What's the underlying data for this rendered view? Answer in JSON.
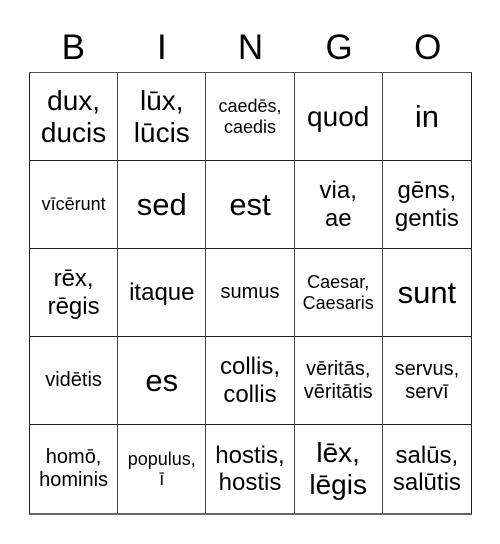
{
  "header": {
    "letters": [
      "B",
      "I",
      "N",
      "G",
      "O"
    ]
  },
  "board": {
    "cells": [
      {
        "text": "dux,\nducis",
        "size": "l"
      },
      {
        "text": "lūx,\nlūcis",
        "size": "l"
      },
      {
        "text": "caedēs,\ncaedis",
        "size": "xs"
      },
      {
        "text": "quod",
        "size": "l"
      },
      {
        "text": "in",
        "size": "xl"
      },
      {
        "text": "vīcērunt",
        "size": "xs"
      },
      {
        "text": "sed",
        "size": "xl"
      },
      {
        "text": "est",
        "size": "xl"
      },
      {
        "text": "via,\nae",
        "size": "m"
      },
      {
        "text": "gēns,\ngentis",
        "size": "m"
      },
      {
        "text": "rēx,\nrēgis",
        "size": "m"
      },
      {
        "text": "itaque",
        "size": "m"
      },
      {
        "text": "sumus",
        "size": "s"
      },
      {
        "text": "Caesar,\nCaesaris",
        "size": "xs"
      },
      {
        "text": "sunt",
        "size": "xl"
      },
      {
        "text": "vidētis",
        "size": "s"
      },
      {
        "text": "es",
        "size": "xl"
      },
      {
        "text": "collis,\ncollis",
        "size": "m"
      },
      {
        "text": "vēritās,\nvēritātis",
        "size": "s"
      },
      {
        "text": "servus,\nservī",
        "size": "s"
      },
      {
        "text": "homō,\nhominis",
        "size": "s"
      },
      {
        "text": "populus,\nī",
        "size": "xs"
      },
      {
        "text": "hostis,\nhostis",
        "size": "m"
      },
      {
        "text": "lēx,\nlēgis",
        "size": "l"
      },
      {
        "text": "salūs,\nsalūtis",
        "size": "m"
      }
    ]
  }
}
